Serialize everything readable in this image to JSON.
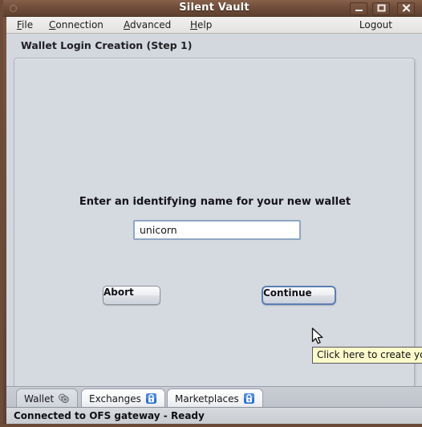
{
  "window": {
    "title": "Silent Vault",
    "controls": {
      "minimize": "minimize-button",
      "maximize": "maximize-button",
      "close": "close-button"
    }
  },
  "menubar": {
    "items": [
      {
        "label": "File",
        "mnemonic": "F"
      },
      {
        "label": "Connection",
        "mnemonic": "C"
      },
      {
        "label": "Advanced",
        "mnemonic": "A"
      },
      {
        "label": "Help",
        "mnemonic": "H"
      }
    ],
    "logout_label": "Logout"
  },
  "content": {
    "step_title": "Wallet Login Creation (Step 1)",
    "prompt": "Enter an identifying name for your new wallet",
    "wallet_name_value": "unicorn",
    "wallet_name_placeholder": "",
    "abort_label": "Abort",
    "continue_label": "Continue",
    "tooltip_text": "Click here to create you"
  },
  "tabs": [
    {
      "label": "Wallet",
      "icon": "coins-icon",
      "selected": true
    },
    {
      "label": "Exchanges",
      "icon": "lock-icon",
      "selected": false
    },
    {
      "label": "Marketplaces",
      "icon": "lock-icon",
      "selected": false
    }
  ],
  "statusbar": {
    "text": "Connected to OFS gateway - Ready"
  },
  "colors": {
    "titlebar": "#6d4b39",
    "client_bg": "#d3d7de",
    "panel_bg": "#d5d9e0",
    "focus_border": "#5a7fb5",
    "tooltip_bg": "#fbfbcc",
    "lock_icon": "#2b6fd4"
  }
}
